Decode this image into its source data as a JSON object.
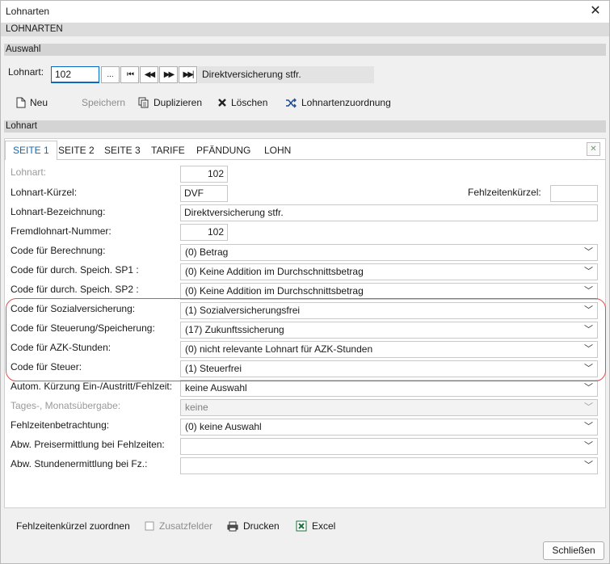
{
  "window": {
    "title": "Lohnarten",
    "close_glyph": "✕"
  },
  "header": {
    "band": "LOHNARTEN"
  },
  "auswahl": {
    "section": "Auswahl",
    "label": "Lohnart:",
    "value": "102",
    "dots": "...",
    "nav": [
      "⏮",
      "◀◀",
      "▶▶",
      "▶▶|"
    ],
    "description": "Direktversicherung stfr."
  },
  "toolbar": {
    "neu": "Neu",
    "speichern": "Speichern",
    "duplizieren": "Duplizieren",
    "loeschen": "Löschen",
    "zuordnung": "Lohnartenzuordnung"
  },
  "lohnart_section": "Lohnart",
  "tabs": [
    "SEITE 1",
    "SEITE 2",
    "SEITE 3",
    "TARIFE",
    "PFÄNDUNG",
    "LOHN"
  ],
  "fields": {
    "lohnart_label": "Lohnart:",
    "lohnart_value": "102",
    "kuerzel_label": "Lohnart-Kürzel:",
    "kuerzel_value": "DVF",
    "fehlzeiten_label": "Fehlzeitenkürzel:",
    "fehlzeiten_value": "",
    "bezeichnung_label": "Lohnart-Bezeichnung:",
    "bezeichnung_value": "Direktversicherung stfr.",
    "fremd_label": "Fremdlohnart-Nummer:",
    "fremd_value": "102"
  },
  "combos": [
    {
      "label": "Code für Berechnung:",
      "value": "(0) Betrag"
    },
    {
      "label": "Code für durch. Speich. SP1 :",
      "value": "(0) Keine Addition im Durchschnittsbetrag"
    },
    {
      "label": "Code für durch. Speich. SP2 :",
      "value": "(0) Keine Addition im Durchschnittsbetrag"
    },
    {
      "label": "Code für Sozialversicherung:",
      "value": "(1) Sozialversicherungsfrei"
    },
    {
      "label": "Code für Steuerung/Speicherung:",
      "value": "(17) Zukunftssicherung"
    },
    {
      "label": "Code für AZK-Stunden:",
      "value": "(0) nicht relevante Lohnart für AZK-Stunden"
    },
    {
      "label": "Code für Steuer:",
      "value": "(1) Steuerfrei"
    },
    {
      "label": "Autom. Kürzung Ein-/Austritt/Fehlzeit:",
      "value": "keine Auswahl"
    },
    {
      "label": "Tages-, Monatsübergabe:",
      "value": "keine"
    },
    {
      "label": "Fehlzeitenbetrachtung:",
      "value": "(0) keine Auswahl"
    },
    {
      "label": "Abw. Preisermittlung bei Fehlzeiten:",
      "value": ""
    },
    {
      "label": "Abw. Stundenermittlung bei Fz.:",
      "value": ""
    }
  ],
  "footer": {
    "fehlzeiten_zuordnen": "Fehlzeitenkürzel zuordnen",
    "zusatzfelder": "Zusatzfelder",
    "drucken": "Drucken",
    "excel": "Excel",
    "schliessen": "Schließen"
  }
}
